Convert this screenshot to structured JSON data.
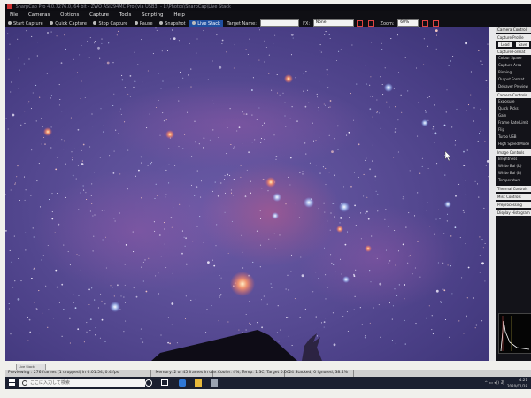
{
  "window": {
    "title": "SharpCap Pro 4.0.7276.0, 64 bit  -  ZWO ASI294MC Pro (via USB3)  -  L:\\Photos\\SharpCap\\Live Stack"
  },
  "menu": [
    "File",
    "Cameras",
    "Options",
    "Capture",
    "Tools",
    "Scripting",
    "Help"
  ],
  "toolbar": {
    "start_capture": "Start Capture",
    "quick_capture": "Quick Capture",
    "stop_capture": "Stop Capture",
    "pause": "Pause",
    "snapshot": "Snapshot",
    "live_stack": "Live Stack",
    "target_name_label": "Target Name:",
    "target_name_value": "",
    "fx_label": "FX:",
    "fx_value": "None",
    "zoom_label": "Zoom:",
    "zoom_value": "60%"
  },
  "right_panel": {
    "title": "Camera Control",
    "sections": [
      {
        "title": "Capture Profile",
        "rows": []
      },
      {
        "title": "Capture Format",
        "rows": [
          "Colour Space",
          "Capture Area",
          "Binning",
          "Output Format",
          "Debayer Preview"
        ]
      },
      {
        "title": "Camera Controls",
        "rows": [
          "Exposure",
          "Quick Picks",
          "Gain",
          "Frame Rate Limit",
          "Flip",
          "Turbo USB",
          "High Speed Mode"
        ]
      },
      {
        "title": "Image Controls",
        "rows": [
          "Brightness",
          "White Bal (R)",
          "White Bal (B)",
          "Temperature"
        ]
      },
      {
        "title": "Thermal Controls",
        "rows": []
      },
      {
        "title": "Misc Controls",
        "rows": []
      },
      {
        "title": "Preprocessing",
        "rows": []
      },
      {
        "title": "Display Histogram",
        "rows": []
      }
    ],
    "load_button": "Load",
    "save_button": "Save"
  },
  "status": {
    "small_tab": "Live Stack",
    "previewing": "Previewing : 276 frames (1 dropped) in 0:01:54, 0.4 fps",
    "memory": "Memory: 2 of 45 frames in use.",
    "cooler": "Cooler: 4%, Temp: 1.3C, Target 0.0C",
    "stacked": "24 Stacked, 0 Ignored, 38.4%"
  },
  "taskbar": {
    "search_placeholder": "ここに入力して検索",
    "time": "4:21",
    "date": "2020/01/28"
  },
  "colors": {
    "accent_live_stack": "#1f4fa0",
    "sky": "#5c4f98"
  }
}
